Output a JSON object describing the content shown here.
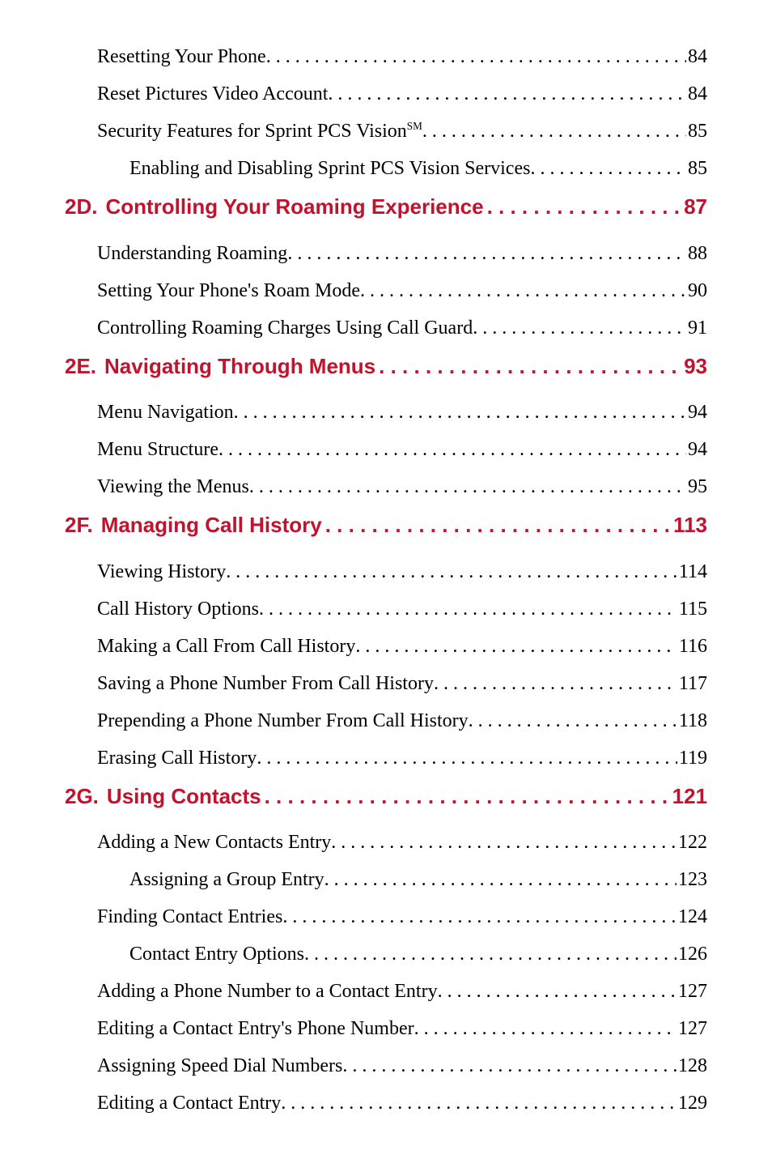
{
  "colors": {
    "accent": "#c1122e",
    "text": "#000000"
  },
  "items": [
    {
      "type": "item",
      "level": 1,
      "label": "Resetting Your Phone",
      "page": "84"
    },
    {
      "type": "item",
      "level": 1,
      "label": "Reset Pictures Video Account",
      "page": "84"
    },
    {
      "type": "item",
      "level": 1,
      "label": "Security Features for Sprint PCS Vision",
      "suffix_sm": true,
      "page": "85"
    },
    {
      "type": "item",
      "level": 2,
      "label": "Enabling and Disabling Sprint PCS Vision Services",
      "page": "85"
    },
    {
      "type": "section",
      "code": "2D.",
      "title": "Controlling Your Roaming Experience",
      "page": "87"
    },
    {
      "type": "item",
      "level": 1,
      "label": "Understanding Roaming",
      "page": "88"
    },
    {
      "type": "item",
      "level": 1,
      "label": "Setting Your Phone's Roam Mode",
      "page": "90"
    },
    {
      "type": "item",
      "level": 1,
      "label": "Controlling Roaming Charges Using Call Guard",
      "page": "91"
    },
    {
      "type": "section",
      "code": "2E.",
      "title": "Navigating Through Menus",
      "page": "93"
    },
    {
      "type": "item",
      "level": 1,
      "label": "Menu Navigation",
      "page": "94"
    },
    {
      "type": "item",
      "level": 1,
      "label": "Menu Structure",
      "page": "94"
    },
    {
      "type": "item",
      "level": 1,
      "label": "Viewing the Menus",
      "page": "95"
    },
    {
      "type": "section",
      "code": "2F.",
      "title": "Managing Call History",
      "page": "113"
    },
    {
      "type": "item",
      "level": 1,
      "label": "Viewing History",
      "page": "114"
    },
    {
      "type": "item",
      "level": 1,
      "label": "Call History Options",
      "page": "115"
    },
    {
      "type": "item",
      "level": 1,
      "label": "Making a Call From Call History",
      "page": "116"
    },
    {
      "type": "item",
      "level": 1,
      "label": "Saving a Phone Number From Call History",
      "page": "117"
    },
    {
      "type": "item",
      "level": 1,
      "label": "Prepending a Phone Number From Call History",
      "page": "118"
    },
    {
      "type": "item",
      "level": 1,
      "label": "Erasing Call History",
      "page": "119"
    },
    {
      "type": "section",
      "code": "2G.",
      "title": "Using Contacts",
      "page": "121"
    },
    {
      "type": "item",
      "level": 1,
      "label": "Adding a New Contacts Entry",
      "page": "122"
    },
    {
      "type": "item",
      "level": 2,
      "label": "Assigning a Group Entry",
      "page": "123"
    },
    {
      "type": "item",
      "level": 1,
      "label": "Finding Contact Entries",
      "page": "124"
    },
    {
      "type": "item",
      "level": 2,
      "label": "Contact Entry Options",
      "page": "126"
    },
    {
      "type": "item",
      "level": 1,
      "label": "Adding a Phone Number to a Contact Entry",
      "page": "127"
    },
    {
      "type": "item",
      "level": 1,
      "label": "Editing a Contact Entry's Phone Number",
      "page": "127"
    },
    {
      "type": "item",
      "level": 1,
      "label": "Assigning Speed Dial Numbers",
      "page": "128"
    },
    {
      "type": "item",
      "level": 1,
      "label": "Editing a Contact Entry",
      "page": "129"
    }
  ]
}
